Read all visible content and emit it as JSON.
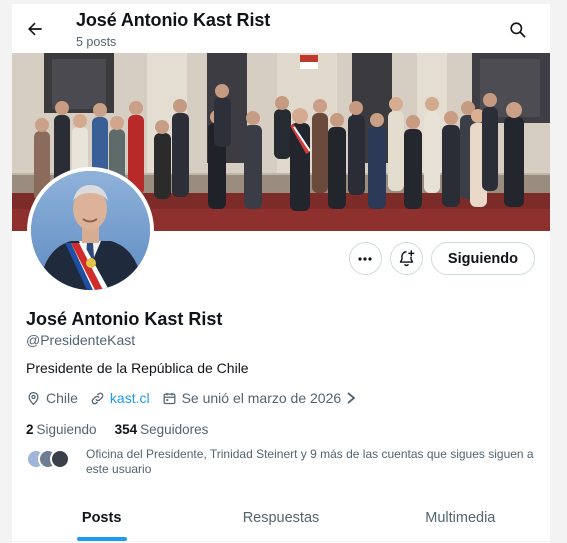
{
  "header": {
    "title": "José Antonio Kast Rist",
    "post_count": "5 posts"
  },
  "profile": {
    "name": "José Antonio Kast Rist",
    "handle": "@PresidenteKast",
    "bio": "Presidente de la República de Chile",
    "location": "Chile",
    "website": "kast.cl",
    "joined": "Se unió el marzo de 2026",
    "following_count": "2",
    "following_label": "Siguiendo",
    "followers_count": "354",
    "followers_label": "Seguidores",
    "known_followers": "Oficina del Presidente, Trinidad Steinert y 9 más de las cuentas que sigues siguen a este usuario"
  },
  "actions": {
    "more_icon": "more-icon",
    "notify_icon": "bell-plus-icon",
    "follow_label": "Siguiendo"
  },
  "tabs": [
    {
      "label": "Posts",
      "active": true
    },
    {
      "label": "Respuestas",
      "active": false
    },
    {
      "label": "Multimedia",
      "active": false
    }
  ],
  "colors": {
    "accent": "#1d9bf0",
    "text": "#0f1419",
    "muted": "#536471",
    "border": "#cfd9de"
  }
}
